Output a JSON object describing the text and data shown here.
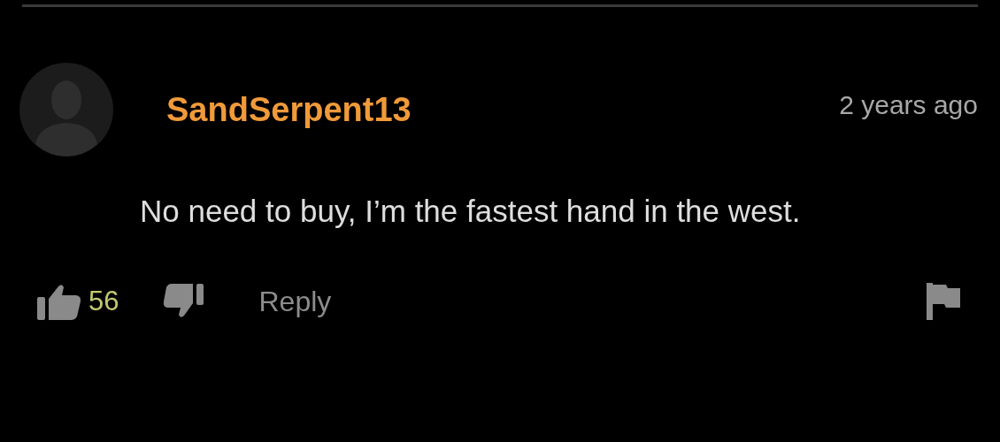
{
  "comment": {
    "username": "SandSerpent13",
    "time": "2 years ago",
    "text": "No need to buy, I’m the fastest hand in the west.",
    "likes": "56",
    "reply": "Reply"
  }
}
